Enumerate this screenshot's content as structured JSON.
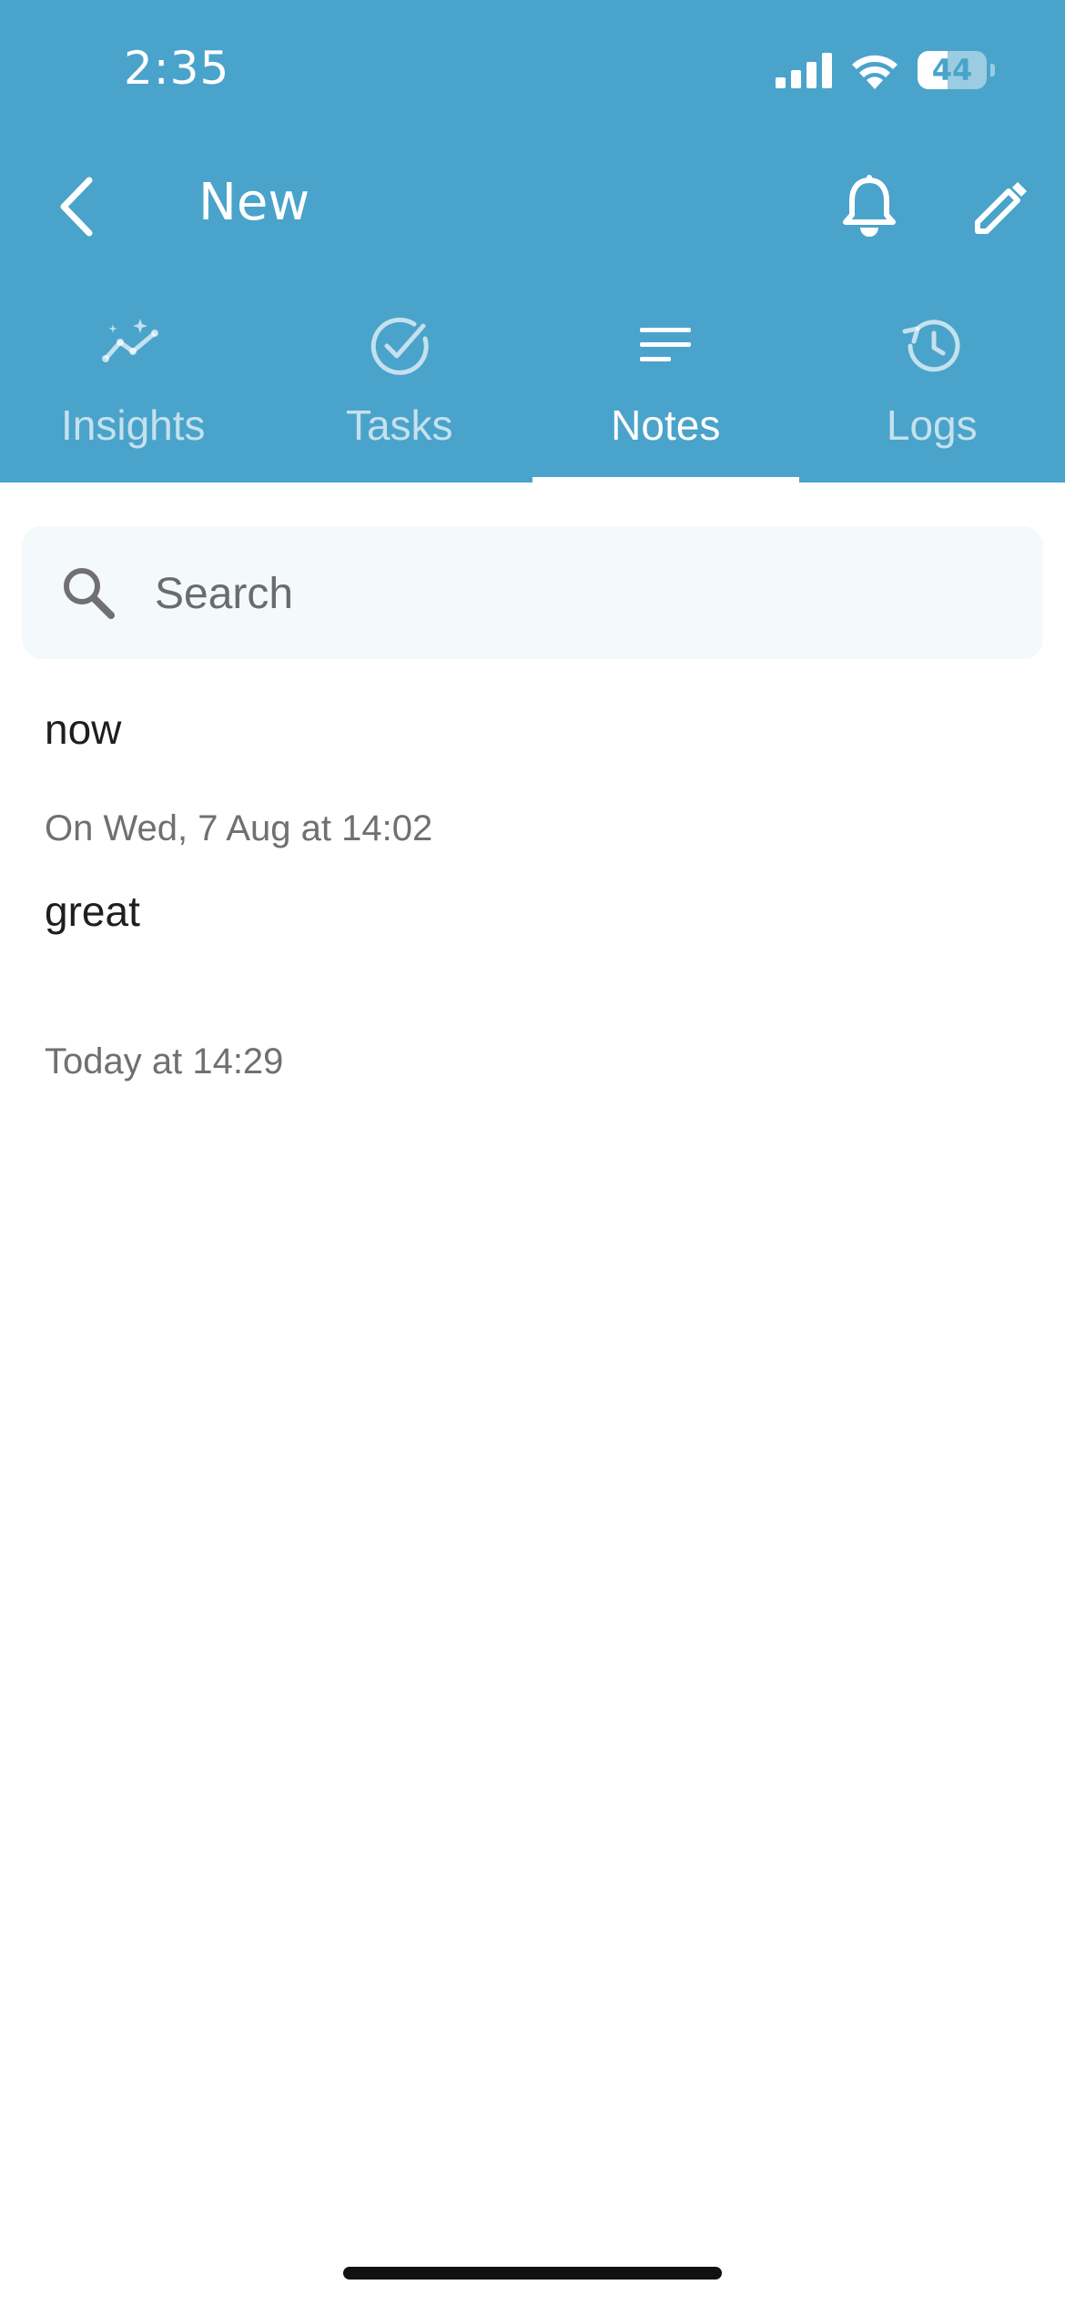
{
  "status_bar": {
    "time": "2:35",
    "battery_text": "44",
    "battery_level": 0.44
  },
  "nav": {
    "title": "New"
  },
  "tabs": [
    {
      "label": "Insights",
      "icon": "insights-icon",
      "active": false
    },
    {
      "label": "Tasks",
      "icon": "check-circle-icon",
      "active": false
    },
    {
      "label": "Notes",
      "icon": "notes-lines-icon",
      "active": true
    },
    {
      "label": "Logs",
      "icon": "history-icon",
      "active": false
    }
  ],
  "search": {
    "placeholder": "Search",
    "value": ""
  },
  "notes": [
    {
      "text": "now",
      "date": "On Wed, 7 Aug at 14:02"
    },
    {
      "text": "great",
      "date": "Today at 14:29"
    }
  ],
  "colors": {
    "header": "#4aa3ca",
    "search_bg": "#f4fafc",
    "date_text": "#707070"
  }
}
